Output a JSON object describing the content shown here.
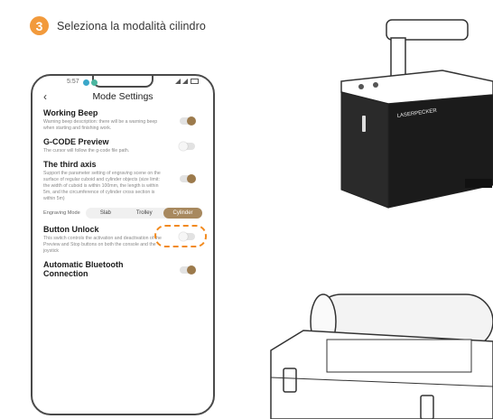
{
  "step": {
    "number": "3",
    "instruction": "Seleziona la modalità cilindro",
    "badge_color": "#f29a3c"
  },
  "phone": {
    "status_time": "5:57",
    "header": {
      "title": "Mode Settings",
      "back_icon": "chevron-left-icon"
    },
    "settings": [
      {
        "title": "Working Beep",
        "description": "Warning beep description: there will be a warning beep when starting and finishing work.",
        "enabled": true
      },
      {
        "title": "G-CODE Preview",
        "description": "The cursor will follow the g-code file path.",
        "enabled": false
      },
      {
        "title": "The third axis",
        "description": "Support the parameter setting of engraving scene on the surface of regular cuboid and cylinder objects (size limit: the width of cuboid is within 100mm, the length is within 5m, and the circumference of cylinder cross section is within 5m)",
        "enabled": true
      },
      {
        "title": "Button Unlock",
        "description": "This switch controls the activation and deactivation of the Preview and Stop buttons on both the console and the joystick",
        "enabled": false
      },
      {
        "title": "Automatic Bluetooth Connection",
        "description": "",
        "enabled": true
      }
    ],
    "engraving_mode": {
      "label": "Engraving Mode",
      "options": [
        "Slab",
        "Trolley",
        "Cylinder"
      ],
      "selected": "Cylinder"
    },
    "accent_color": "#9c7a4c"
  },
  "device": {
    "brand_label": "LASERPECKER"
  },
  "highlight_color": "#f28a1e"
}
